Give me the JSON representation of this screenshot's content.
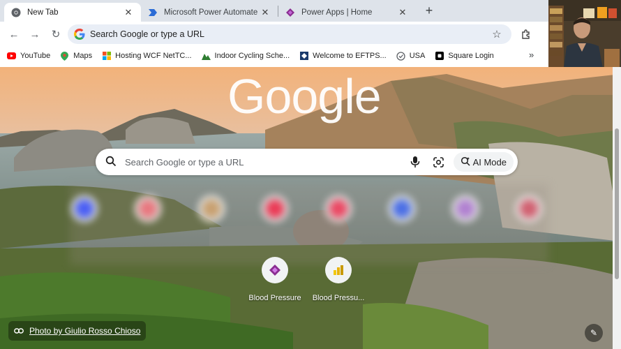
{
  "tabs": [
    {
      "title": "New Tab",
      "icon": "chrome-icon",
      "active": true
    },
    {
      "title": "Microsoft Power Automate | Ho",
      "icon": "power-automate-icon",
      "active": false
    },
    {
      "title": "Power Apps | Home",
      "icon": "power-apps-icon",
      "active": false
    }
  ],
  "tab_close_glyph": "✕",
  "new_tab_glyph": "+",
  "toolbar": {
    "back_glyph": "←",
    "forward_glyph": "→",
    "reload_glyph": "↻",
    "omnibox_text": "Search Google or type a URL",
    "bookmark_glyph": "☆"
  },
  "bookmarks": [
    {
      "label": "YouTube",
      "icon": "youtube-icon",
      "color": "#ff0000"
    },
    {
      "label": "Maps",
      "icon": "maps-icon",
      "color": "#34a853"
    },
    {
      "label": "Hosting WCF NetTC...",
      "icon": "windows-icon",
      "color": "#f25022"
    },
    {
      "label": "Indoor Cycling Sche...",
      "icon": "mountain-icon",
      "color": "#2e7d32"
    },
    {
      "label": "Welcome to EFTPS...",
      "icon": "eftps-icon",
      "color": "#1a3a6b"
    },
    {
      "label": "USA",
      "icon": "usa-icon",
      "color": "#5f6368"
    },
    {
      "label": "Square Login",
      "icon": "square-icon",
      "color": "#000000"
    }
  ],
  "bookmarks_more_glyph": "»",
  "ntp": {
    "logo_text": "Google",
    "search_placeholder": "Search Google or type a URL",
    "ai_mode_label": "AI Mode",
    "shortcuts_blurred_colors": [
      "#4a5ef5",
      "#e8777f",
      "#c8a070",
      "#ea3a55",
      "#ea4863",
      "#4a6ee5",
      "#b080d0",
      "#d06070"
    ],
    "tiles": [
      {
        "label": "Blood Pressure",
        "icon": "power-apps-icon"
      },
      {
        "label": "Blood Pressu...",
        "icon": "power-bi-icon"
      }
    ],
    "attribution": "Photo by Giulio Rosso Chioso",
    "customize_glyph": "✎"
  }
}
